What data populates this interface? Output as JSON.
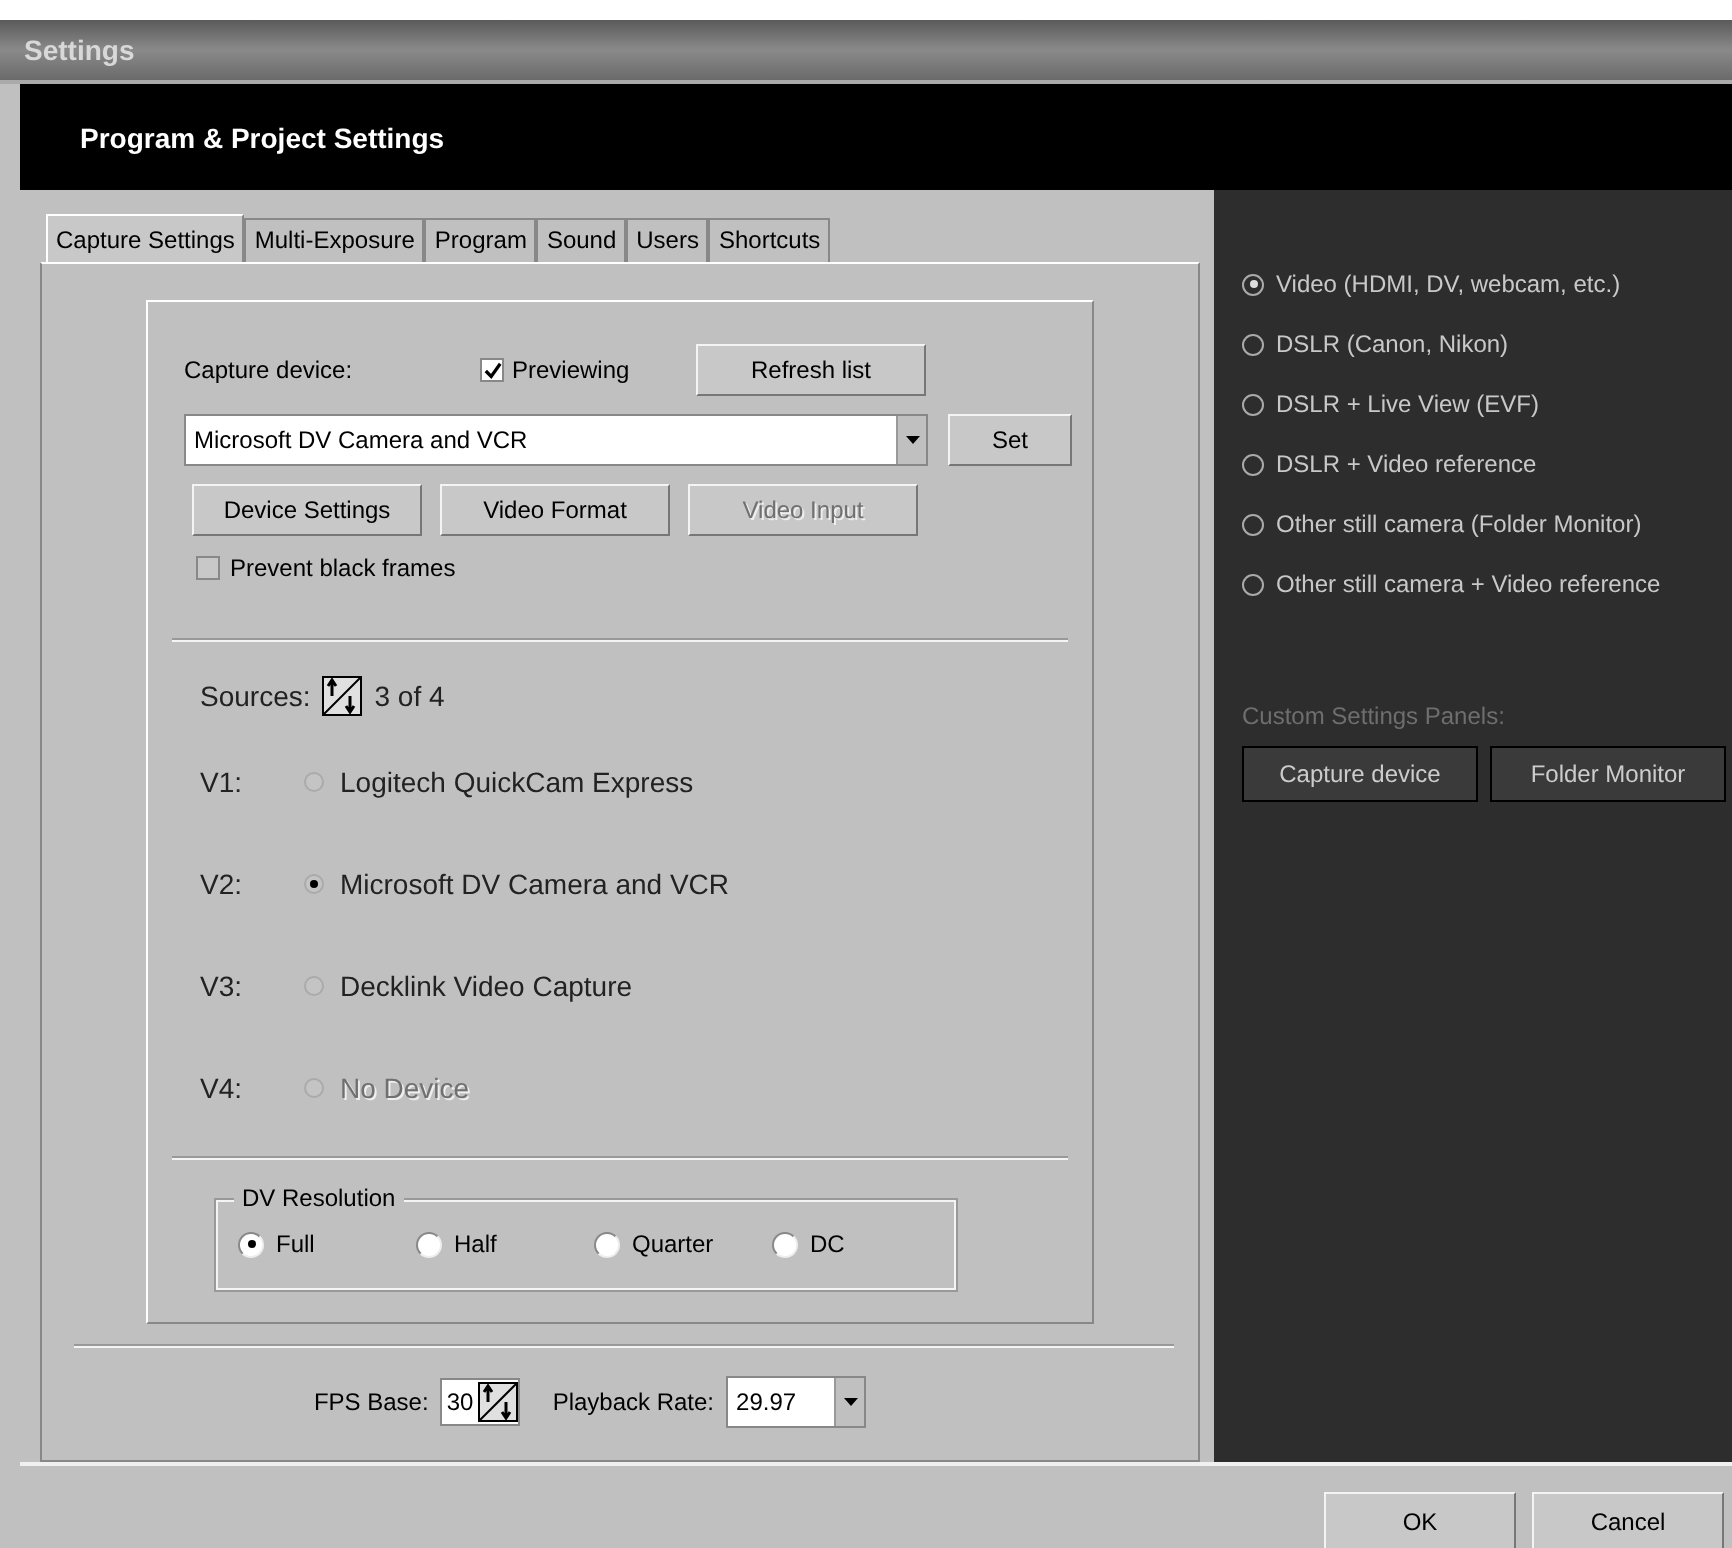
{
  "window": {
    "title": "Settings"
  },
  "header": "Program & Project Settings",
  "tabs": [
    {
      "label": "Capture Settings",
      "selected": true
    },
    {
      "label": "Multi-Exposure",
      "selected": false
    },
    {
      "label": "Program",
      "selected": false
    },
    {
      "label": "Sound",
      "selected": false
    },
    {
      "label": "Users",
      "selected": false
    },
    {
      "label": "Shortcuts",
      "selected": false
    }
  ],
  "capture": {
    "label": "Capture device:",
    "previewing": {
      "label": "Previewing",
      "checked": true
    },
    "refresh_button": "Refresh list",
    "device_value": "Microsoft DV Camera and VCR",
    "set_button": "Set",
    "buttons": [
      {
        "label": "Device Settings",
        "disabled": false
      },
      {
        "label": "Video Format",
        "disabled": false
      },
      {
        "label": "Video Input",
        "disabled": true
      }
    ],
    "prevent_black_frames": {
      "label": "Prevent black frames",
      "checked": false
    }
  },
  "sources": {
    "label": "Sources:",
    "count": "3 of 4",
    "items": [
      {
        "slot": "V1:",
        "name": "Logitech QuickCam Express",
        "selected": false,
        "disabled": false
      },
      {
        "slot": "V2:",
        "name": "Microsoft DV Camera and VCR",
        "selected": true,
        "disabled": false
      },
      {
        "slot": "V3:",
        "name": "Decklink Video Capture",
        "selected": false,
        "disabled": false
      },
      {
        "slot": "V4:",
        "name": "No Device",
        "selected": false,
        "disabled": true
      }
    ]
  },
  "dv_resolution": {
    "title": "DV Resolution",
    "options": [
      {
        "label": "Full",
        "selected": true
      },
      {
        "label": "Half",
        "selected": false
      },
      {
        "label": "Quarter",
        "selected": false
      },
      {
        "label": "DC",
        "selected": false
      }
    ]
  },
  "fps_base": {
    "label": "FPS Base:",
    "value": "30"
  },
  "playback_rate": {
    "label": "Playback Rate:",
    "value": "29.97"
  },
  "modes": [
    {
      "label": "Video (HDMI, DV, webcam, etc.)",
      "selected": true
    },
    {
      "label": "DSLR (Canon, Nikon)",
      "selected": false
    },
    {
      "label": "DSLR + Live View (EVF)",
      "selected": false
    },
    {
      "label": "DSLR + Video reference",
      "selected": false
    },
    {
      "label": "Other still camera (Folder Monitor)",
      "selected": false
    },
    {
      "label": "Other still camera + Video reference",
      "selected": false
    }
  ],
  "custom_panels": {
    "label": "Custom Settings Panels:",
    "buttons": [
      "Capture device",
      "Folder Monitor"
    ]
  },
  "footer_buttons": [
    "OK",
    "Cancel"
  ]
}
